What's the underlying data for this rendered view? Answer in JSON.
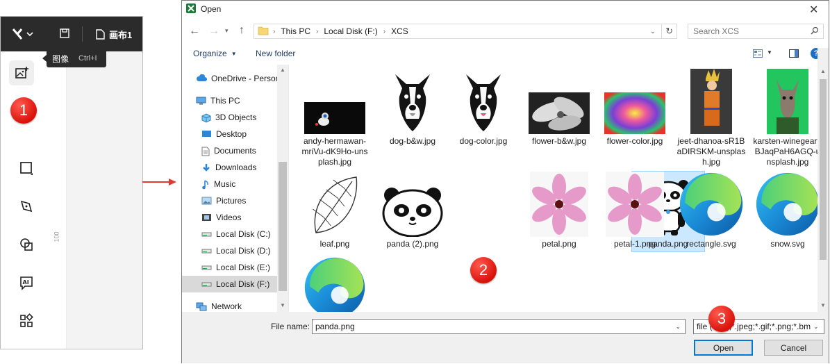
{
  "app": {
    "canvas_name": "画布1",
    "tooltip_label": "图像",
    "tooltip_shortcut": "Ctrl+I",
    "ruler_label": "100"
  },
  "markers": [
    "1",
    "2",
    "3"
  ],
  "dialog": {
    "title": "Open",
    "breadcrumb": [
      "This PC",
      "Local Disk (F:)",
      "XCS"
    ],
    "search_placeholder": "Search XCS",
    "organize": "Organize",
    "new_folder": "New folder",
    "nav": [
      {
        "label": "OneDrive - Person",
        "icon": "cloud-icon"
      },
      {
        "label": "This PC",
        "icon": "computer-icon"
      },
      {
        "label": "3D Objects",
        "icon": "cube-icon"
      },
      {
        "label": "Desktop",
        "icon": "desktop-icon"
      },
      {
        "label": "Documents",
        "icon": "document-icon"
      },
      {
        "label": "Downloads",
        "icon": "download-icon"
      },
      {
        "label": "Music",
        "icon": "music-icon"
      },
      {
        "label": "Pictures",
        "icon": "picture-icon"
      },
      {
        "label": "Videos",
        "icon": "video-icon"
      },
      {
        "label": "Local Disk (C:)",
        "icon": "drive-icon"
      },
      {
        "label": "Local Disk (D:)",
        "icon": "drive-icon"
      },
      {
        "label": "Local Disk (E:)",
        "icon": "drive-icon"
      },
      {
        "label": "Local Disk (F:)",
        "icon": "drive-icon",
        "selected": true
      },
      {
        "label": "Network",
        "icon": "network-icon"
      }
    ],
    "files": [
      {
        "name": "andy-hermawan-mriVu-dK9Ho-unsplash.jpg"
      },
      {
        "name": "dog-b&w.jpg"
      },
      {
        "name": "dog-color.jpg"
      },
      {
        "name": "flower-b&w.jpg"
      },
      {
        "name": "flower-color.jpg"
      },
      {
        "name": "jeet-dhanoa-sR1BaDIRSKM-unsplash.jpg"
      },
      {
        "name": "karsten-winegeart-BJaqPaH6AGQ-unsplash.jpg"
      },
      {
        "name": "leaf.png"
      },
      {
        "name": "panda (2).png"
      },
      {
        "name": "panda.png",
        "selected": true
      },
      {
        "name": "petal.png"
      },
      {
        "name": "petal-1.png"
      },
      {
        "name": "rectangle.svg"
      },
      {
        "name": "snow.svg"
      },
      {
        "name": ""
      }
    ],
    "file_name_label": "File name:",
    "file_name_value": "panda.png",
    "file_type_value": "file (*.jpg;*.jpeg;*.gif;*.png;*.bm",
    "open_button": "Open",
    "cancel_button": "Cancel"
  }
}
